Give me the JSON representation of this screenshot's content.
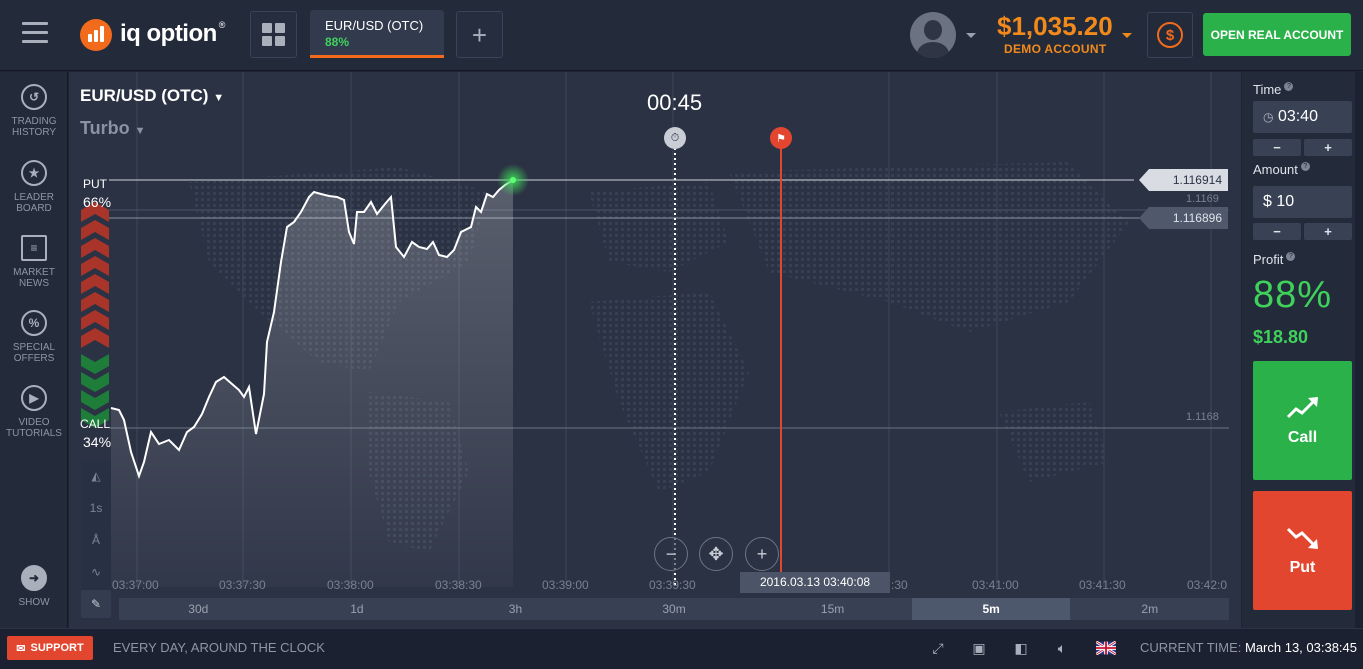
{
  "header": {
    "logo_text": "iq option",
    "logo_reg": "®",
    "asset_tab": {
      "name": "EUR/USD (OTC)",
      "profit": "88%"
    },
    "balance": "$1,035.20",
    "account_type": "DEMO ACCOUNT",
    "open_real_label": "OPEN REAL ACCOUNT"
  },
  "sidebar": {
    "items": [
      {
        "label": "TRADING HISTORY",
        "icon": "history-icon"
      },
      {
        "label": "LEADER BOARD",
        "icon": "leaderboard-icon"
      },
      {
        "label": "MARKET NEWS",
        "icon": "news-icon"
      },
      {
        "label": "SPECIAL OFFERS",
        "icon": "offers-icon"
      },
      {
        "label": "VIDEO TUTORIALS",
        "icon": "video-icon"
      }
    ],
    "show_label": "SHOW"
  },
  "chart": {
    "asset": "EUR/USD (OTC)",
    "mode": "Turbo",
    "countdown": "00:45",
    "put_label": "PUT",
    "put_pct": "66%",
    "call_label": "CALL",
    "call_pct": "34%",
    "current_price": "1.116914",
    "strike_price": "1.116896",
    "level_upper": "1.1169",
    "level_lower": "1.1168",
    "expiration_tooltip": "2016.03.13 03:40:08",
    "time_labels": [
      "03:37:00",
      "03:37:30",
      "03:38:00",
      "03:38:30",
      "03:39:00",
      "03:39:30",
      ":30",
      "03:41:00",
      "03:41:30",
      "03:42:0"
    ],
    "timeframes": [
      "30d",
      "1d",
      "3h",
      "30m",
      "15m",
      "5m",
      "2m"
    ],
    "active_timeframe": "5m",
    "tool_1s": "1s",
    "zoom_out": "−",
    "zoom_in": "+"
  },
  "panel": {
    "time_label": "Time",
    "time_value": "03:40",
    "amount_label": "Amount",
    "amount_value": "$ 10",
    "profit_label": "Profit",
    "profit_pct": "88%",
    "profit_amount": "$18.80",
    "call_label": "Call",
    "put_label": "Put",
    "minus": "−",
    "plus": "+"
  },
  "footer": {
    "support_label": "SUPPORT",
    "slogan": "EVERY DAY, AROUND THE CLOCK",
    "current_time_label": "CURRENT TIME:",
    "current_time_value": "March 13, 03:38:45"
  },
  "colors": {
    "brand_orange": "#f26a1b",
    "call_green": "#2ab14a",
    "put_red": "#e3462f",
    "profit_green": "#3fd25b"
  }
}
